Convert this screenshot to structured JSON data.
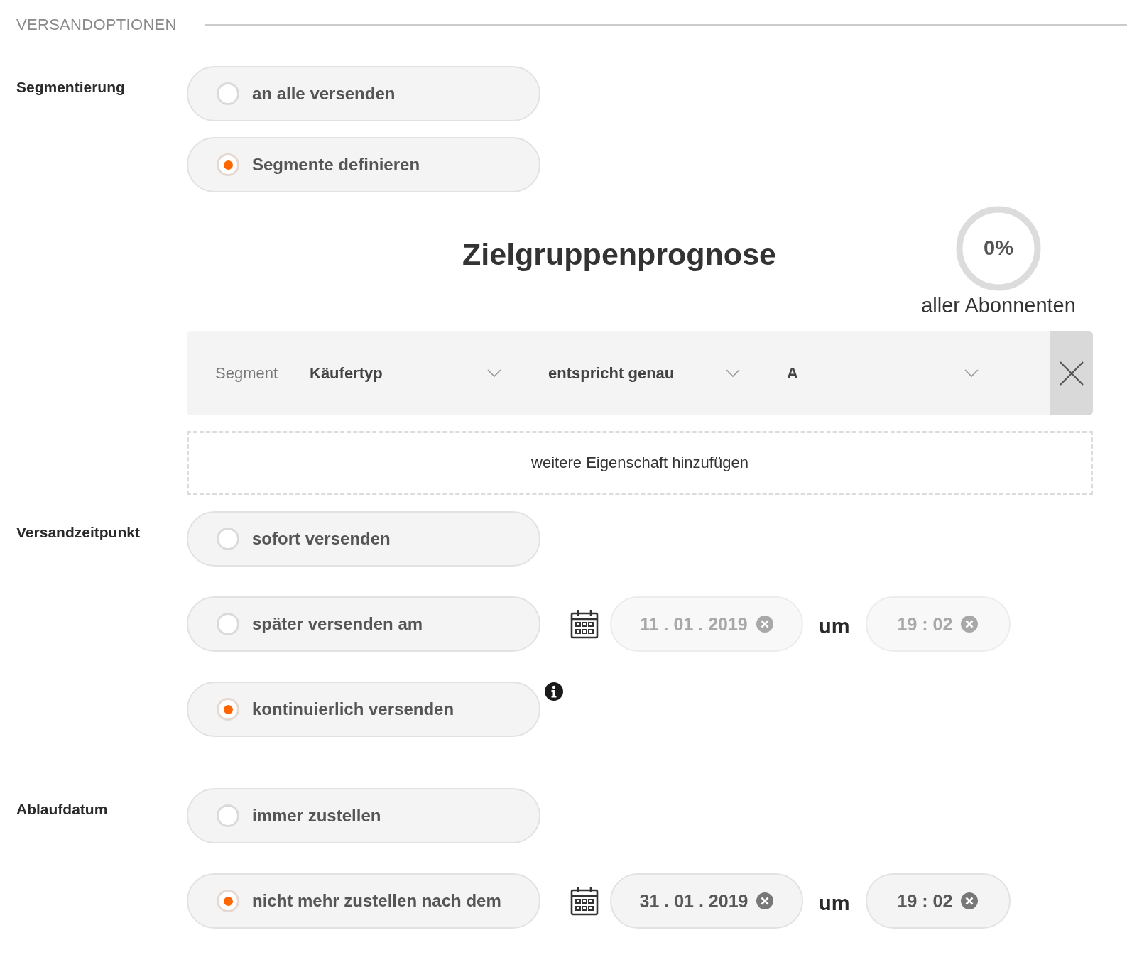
{
  "section_title": "VERSANDOPTIONEN",
  "groups": [
    {
      "label": "Segmentierung",
      "options": [
        {
          "label": "an alle versenden",
          "selected": false
        },
        {
          "label": "Segmente definieren",
          "selected": true
        }
      ],
      "segment_builder": {
        "forecast": {
          "title": "Zielgruppenprognose",
          "percent": "0%",
          "caption": "aller Abonnenten"
        },
        "rule": {
          "label": "Segment",
          "selects": [
            {
              "value": "Käufertyp"
            },
            {
              "value": "entspricht genau"
            },
            {
              "value": "A"
            }
          ]
        },
        "add_button": "weitere Eigenschaft hinzufügen"
      }
    },
    {
      "label": "Versandzeitpunkt",
      "options": [
        {
          "label": "sofort versenden",
          "selected": false
        },
        {
          "label": "später versenden am",
          "selected": false,
          "schedule": {
            "date": {
              "value": "11 . 01 . 2019",
              "disabled": true
            },
            "connector": "um",
            "time": {
              "value": "19 : 02",
              "disabled": true
            }
          }
        },
        {
          "label": "kontinuierlich versenden",
          "selected": true,
          "info": true
        }
      ]
    },
    {
      "label": "Ablaufdatum",
      "options": [
        {
          "label": "immer zustellen",
          "selected": false
        },
        {
          "label": "nicht mehr zustellen nach dem",
          "selected": true,
          "schedule": {
            "date": {
              "value": "31 . 01 . 2019",
              "disabled": false
            },
            "connector": "um",
            "time": {
              "value": "19 : 02",
              "disabled": false
            }
          }
        }
      ]
    }
  ]
}
